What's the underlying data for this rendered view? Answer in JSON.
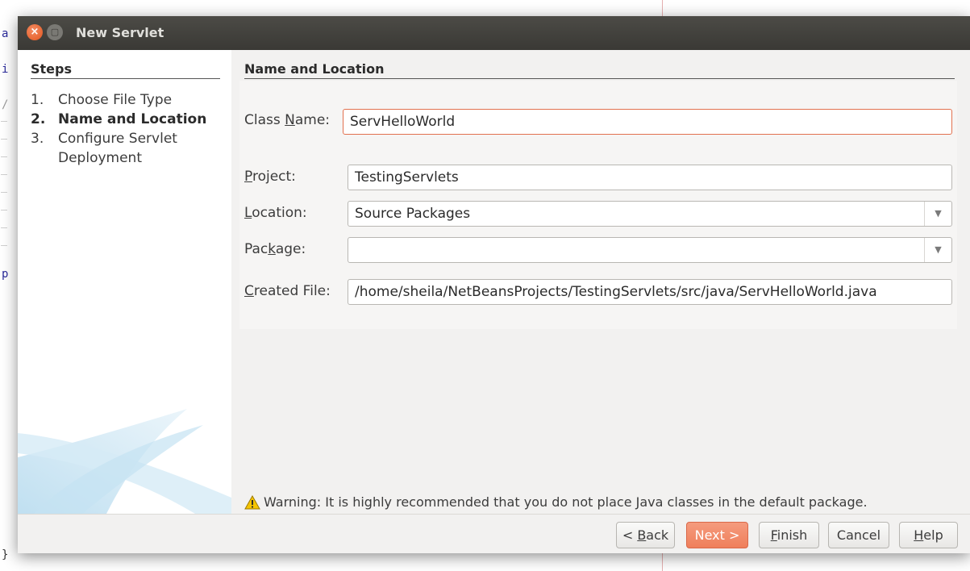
{
  "dialog": {
    "title": "New Servlet"
  },
  "steps": {
    "title": "Steps",
    "items": [
      {
        "num": "1.",
        "label": "Choose File Type",
        "active": false
      },
      {
        "num": "2.",
        "label": "Name and Location",
        "active": true
      },
      {
        "num": "3.",
        "label": "Configure Servlet",
        "active": false
      },
      {
        "num": "",
        "label": "Deployment",
        "active": false
      }
    ]
  },
  "form": {
    "section_title": "Name and Location",
    "class_name_label_pre": "Class ",
    "class_name_label_key": "N",
    "class_name_label_post": "ame:",
    "class_name_value": "ServHelloWorld",
    "project_label_key": "P",
    "project_label_post": "roject:",
    "project_value": "TestingServlets",
    "location_label_key": "L",
    "location_label_post": "ocation:",
    "location_value": "Source Packages",
    "package_label_pre": "Pac",
    "package_label_key": "k",
    "package_label_post": "age:",
    "package_value": "",
    "created_file_label_key": "C",
    "created_file_label_post": "reated File:",
    "created_file_value": "/home/sheila/NetBeansProjects/TestingServlets/src/java/ServHelloWorld.java"
  },
  "warning": {
    "text": "Warning: It is highly recommended that you do not place Java classes in the default package.",
    "color": "#f5c400"
  },
  "buttons": {
    "back_pre": "< ",
    "back_key": "B",
    "back_post": "ack",
    "next": "Next >",
    "finish_key": "F",
    "finish_post": "inish",
    "cancel": "Cancel",
    "help_key": "H",
    "help_post": "elp"
  },
  "editor_fragments": [
    "a",
    "i",
    "/",
    "p",
    "}"
  ],
  "colors": {
    "accent": "#ef7f5b",
    "titlebar": "#3c3b37",
    "close": "#e3561f"
  }
}
